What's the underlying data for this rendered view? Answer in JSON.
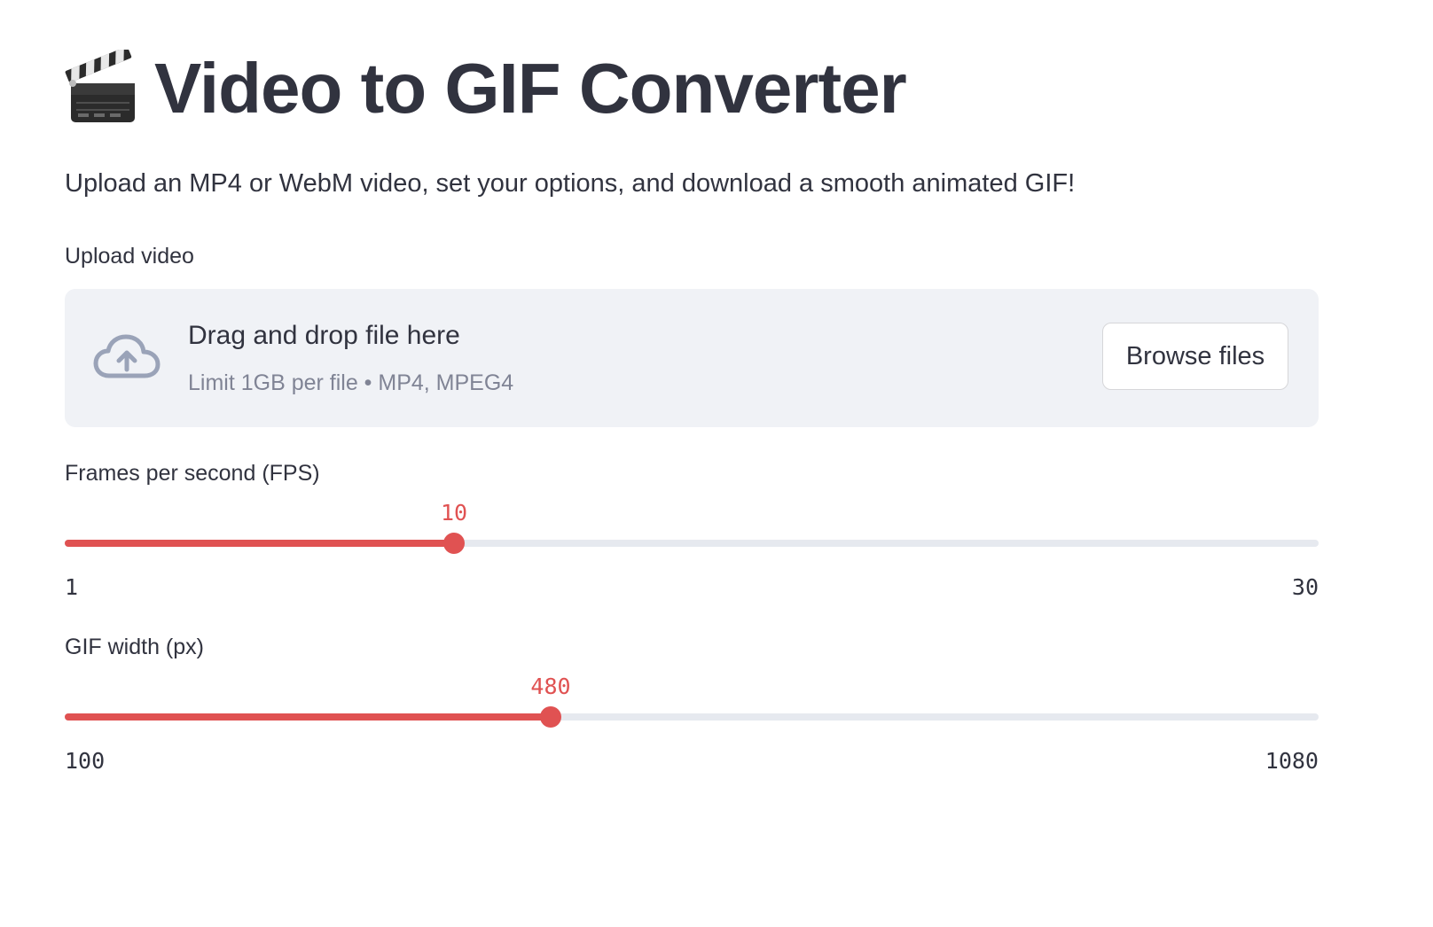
{
  "header": {
    "icon": "clapperboard-icon",
    "title": "Video to GIF Converter",
    "subtitle": "Upload an MP4 or WebM video, set your options, and download a smooth animated GIF!"
  },
  "uploader": {
    "label": "Upload video",
    "icon": "cloud-upload-icon",
    "drop_text": "Drag and drop file here",
    "limit_text": "Limit 1GB per file • MP4, MPEG4",
    "browse_label": "Browse files"
  },
  "fps_slider": {
    "label": "Frames per second (FPS)",
    "min": 1,
    "max": 30,
    "value": 10,
    "min_label": "1",
    "max_label": "30",
    "value_label": "10"
  },
  "width_slider": {
    "label": "GIF width (px)",
    "min": 100,
    "max": 1080,
    "value": 480,
    "min_label": "100",
    "max_label": "1080",
    "value_label": "480"
  },
  "colors": {
    "accent": "#e05252",
    "text": "#31333f",
    "muted": "#808495",
    "uploader_bg": "#f0f2f6",
    "track": "#e6e9ef"
  }
}
